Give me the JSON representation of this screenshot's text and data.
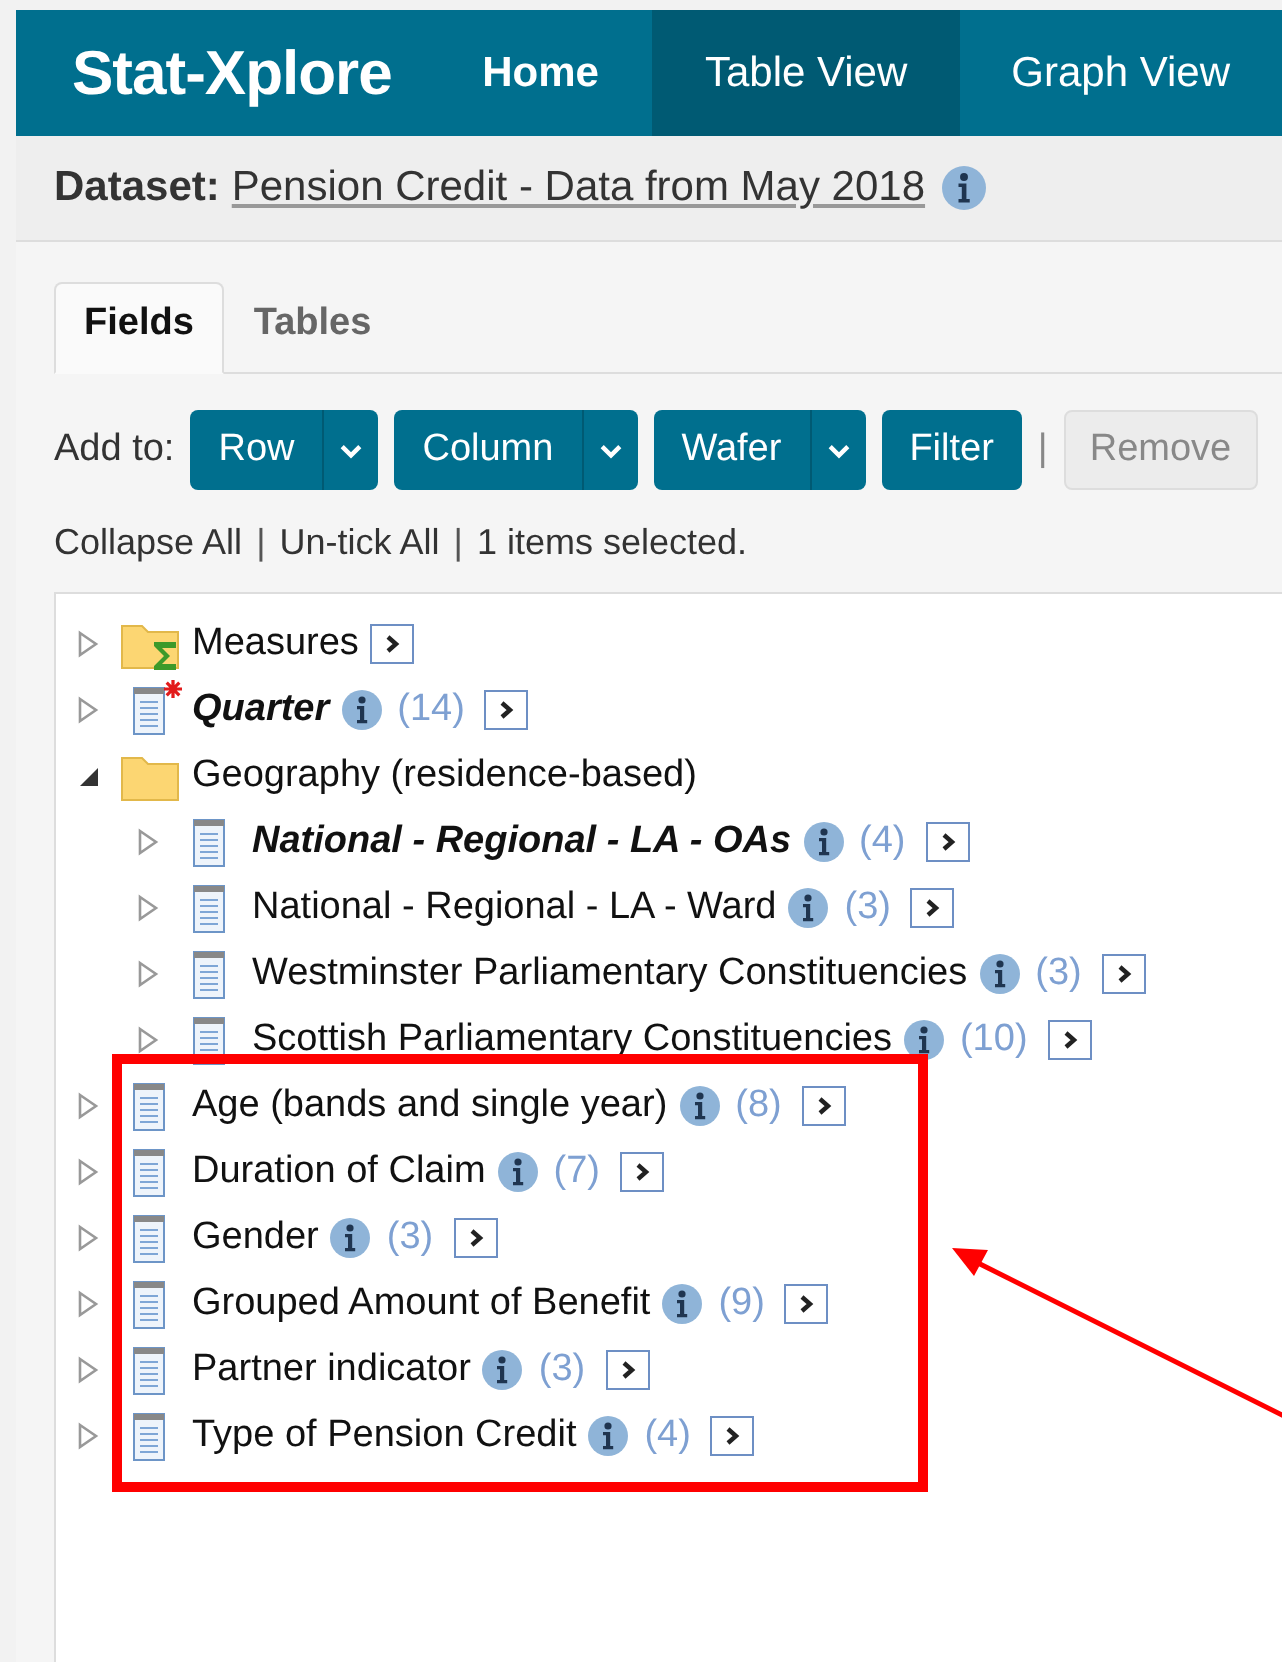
{
  "header": {
    "logo": "Stat-Xplore",
    "nav": [
      {
        "label": "Home",
        "selected": false
      },
      {
        "label": "Table View",
        "selected": true
      },
      {
        "label": "Graph View",
        "selected": false
      }
    ]
  },
  "dataset": {
    "label": "Dataset:",
    "name": "Pension Credit - Data from May 2018"
  },
  "tabs": [
    {
      "label": "Fields",
      "selected": true
    },
    {
      "label": "Tables",
      "selected": false
    }
  ],
  "add_to": {
    "label": "Add to:",
    "items": [
      {
        "kind": "button",
        "label": "Row",
        "dropdown": true,
        "disabled": false
      },
      {
        "kind": "button",
        "label": "Column",
        "dropdown": true,
        "disabled": false
      },
      {
        "kind": "button",
        "label": "Wafer",
        "dropdown": true,
        "disabled": false
      },
      {
        "kind": "button",
        "label": "Filter",
        "disabled": false
      },
      {
        "kind": "separator",
        "label": "|"
      },
      {
        "kind": "button",
        "label": "Remove",
        "disabled": true
      }
    ]
  },
  "actions": [
    {
      "kind": "link",
      "text": "Collapse All"
    },
    {
      "kind": "separator",
      "text": "|"
    },
    {
      "kind": "link",
      "text": "Un-tick All"
    },
    {
      "kind": "separator",
      "text": "|"
    },
    {
      "kind": "status",
      "text": "1 items selected."
    }
  ],
  "tree": [
    {
      "kind": "measures",
      "label": "Measures",
      "emphasis": false,
      "expanded": false
    },
    {
      "kind": "field",
      "label": "Quarter",
      "emphasis": true,
      "marked": true,
      "info": true,
      "count": "(14)",
      "expanded": false
    },
    {
      "kind": "folder",
      "label": "Geography (residence-based)",
      "emphasis": false,
      "expanded": true,
      "children": [
        {
          "kind": "field",
          "label": "National - Regional - LA - OAs",
          "emphasis": true,
          "info": true,
          "count": "(4)",
          "expanded": false
        },
        {
          "kind": "field",
          "label": "National - Regional - LA - Ward",
          "emphasis": false,
          "info": true,
          "count": "(3)",
          "expanded": false
        },
        {
          "kind": "field",
          "label": "Westminster Parliamentary Constituencies",
          "emphasis": false,
          "info": true,
          "count": "(3)",
          "expanded": false
        },
        {
          "kind": "field",
          "label": "Scottish Parliamentary Constituencies",
          "emphasis": false,
          "info": true,
          "count": "(10)",
          "expanded": false
        }
      ]
    },
    {
      "kind": "field",
      "label": "Age (bands and single year)",
      "emphasis": false,
      "info": true,
      "count": "(8)",
      "expanded": false
    },
    {
      "kind": "field",
      "label": "Duration of Claim",
      "emphasis": false,
      "info": true,
      "count": "(7)",
      "expanded": false
    },
    {
      "kind": "field",
      "label": "Gender",
      "emphasis": false,
      "info": true,
      "count": "(3)",
      "expanded": false
    },
    {
      "kind": "field",
      "label": "Grouped Amount of Benefit",
      "emphasis": false,
      "info": true,
      "count": "(9)",
      "expanded": false
    },
    {
      "kind": "field",
      "label": "Partner indicator",
      "emphasis": false,
      "info": true,
      "count": "(3)",
      "expanded": false
    },
    {
      "kind": "field",
      "label": "Type of Pension Credit",
      "emphasis": false,
      "info": true,
      "count": "(4)",
      "expanded": false
    }
  ]
}
